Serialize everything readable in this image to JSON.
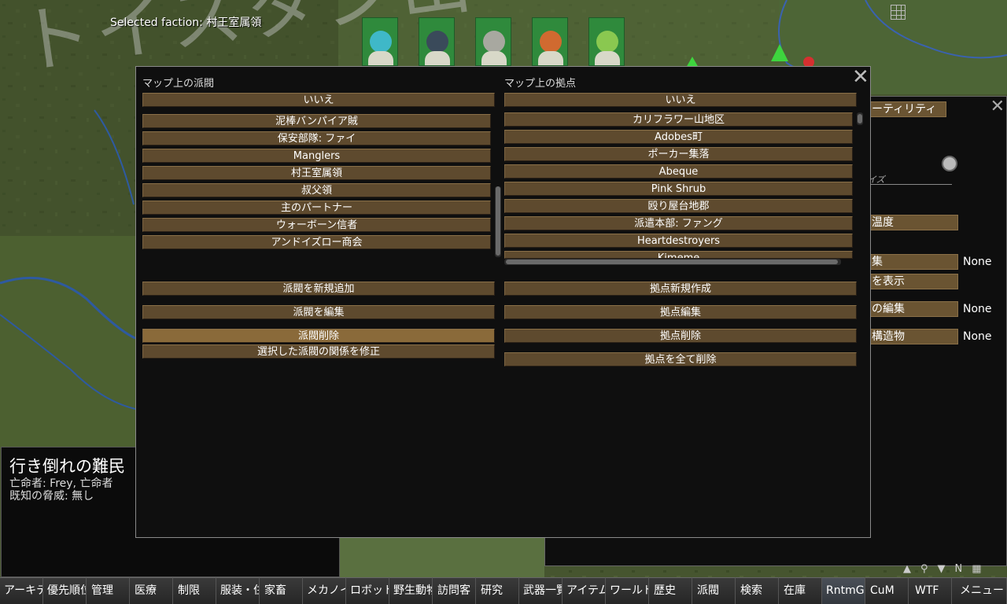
{
  "map": {
    "region_label": "トイスタン山",
    "selected_faction": "Selected faction: 村王室属領"
  },
  "dialog": {
    "left_title": "マップ上の派閥",
    "right_title": "マップ上の拠点",
    "factions": [
      "いいえ",
      "泥棒バンパイア賊",
      "保安部隊: ファイ",
      "Manglers",
      "村王室属領",
      "叔父領",
      "主のパートナー",
      "ウォーボーン信者",
      "アンドイズロー商会"
    ],
    "settlements": [
      "いいえ",
      "カリフラワー山地区",
      "Adobes町",
      "ポーカー集落",
      "Abeque",
      "Pink Shrub",
      "殴り屋台地郡",
      "派遣本部: ファング",
      "Heartdestroyers",
      "Kimeme"
    ],
    "left_actions": [
      "派閥を新規追加",
      "派閥を編集",
      "派閥削除",
      "選択した派閥の関係を修正"
    ],
    "right_actions": [
      "拠点新規作成",
      "拠点編集",
      "拠点削除",
      "拠点を全て削除"
    ]
  },
  "right_panel": {
    "utility_label": "ーティリティ",
    "size_label": "イズ",
    "temperature_label": "温度",
    "rows": [
      {
        "label": "集",
        "value": "None"
      },
      {
        "label": "を表示",
        "value": ""
      },
      {
        "label": "の編集",
        "value": "None"
      },
      {
        "label": "構造物",
        "value": "None"
      }
    ]
  },
  "info_box": {
    "title": "行き倒れの難民",
    "line1": "亡命者: Frey, 亡命者",
    "line2": "既知の脅威: 無し"
  },
  "tabs": [
    "アーキテ",
    "優先順位",
    "管理",
    "医療",
    "制限",
    "服装・住",
    "家畜",
    "メカノイ",
    "ロボット",
    "野生動物",
    "訪問客",
    "研究",
    "武器一覧",
    "アイテム",
    "ワールド",
    "歴史",
    "派閥",
    "検索",
    "在庫",
    "RntmGC",
    "CuM",
    "WTF",
    "メニュー"
  ],
  "colors": {
    "button": "#5e4a2e",
    "button_highlight": "#8a6a3a",
    "dialog_bg": "#0f0f0f",
    "tree_green": "#3ed53e"
  }
}
